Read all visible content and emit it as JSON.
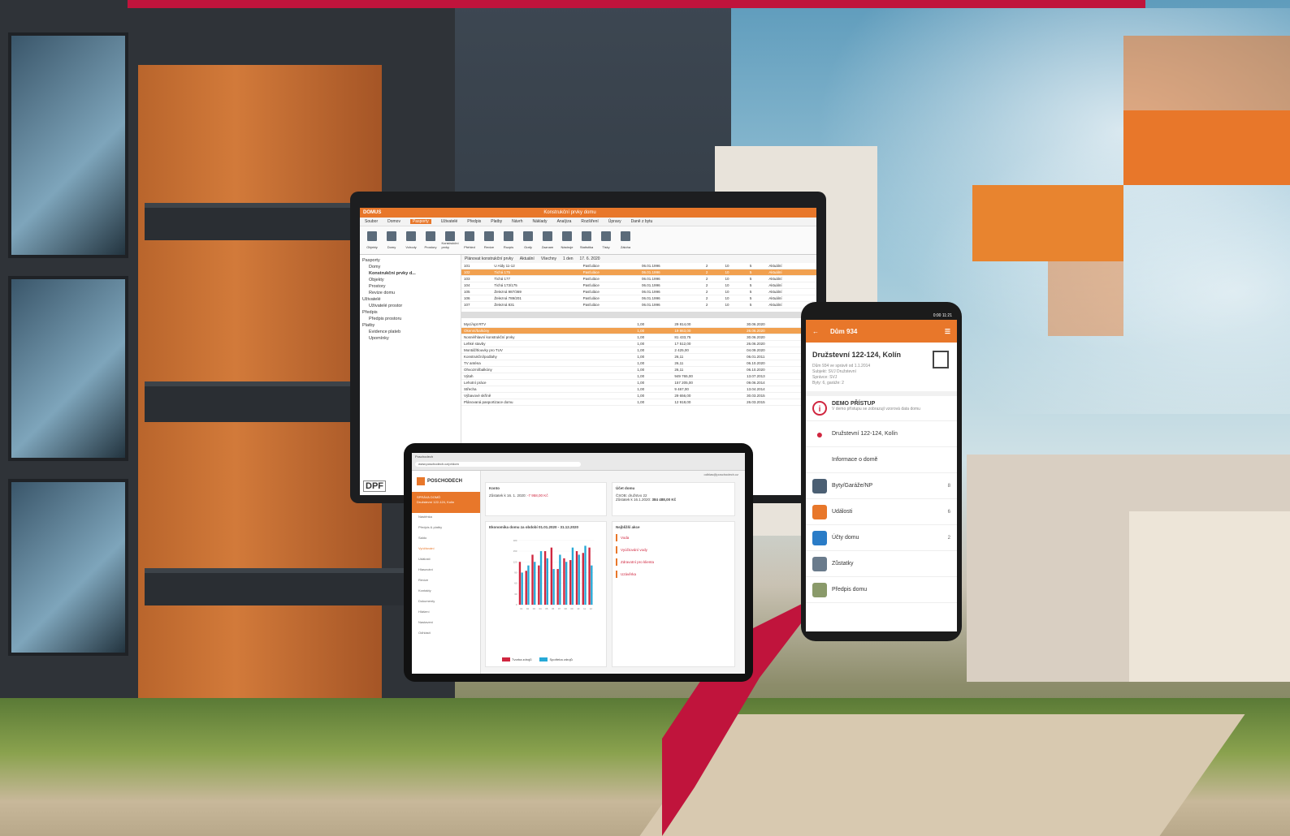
{
  "colors": {
    "accent": "#e8772a",
    "brand_red": "#c0143c",
    "bar_red": "#d0263f",
    "bar_blue": "#27a9d6"
  },
  "laptop": {
    "app_title": "DOMUS",
    "window_title": "Konstrukční prvky domu",
    "menu": [
      "Soubor",
      "Domov",
      "Pasporty",
      "Uživatelé",
      "Předpis",
      "Platby",
      "Návrh",
      "Náklady",
      "Analýza",
      "Rozšíření",
      "Úpravy",
      "Daně z bytu"
    ],
    "active_menu": "Pasporty",
    "ribbon": [
      "Objekty",
      "Domy",
      "Vchody",
      "Prostory",
      "Konstrukční prvky",
      "Přehled",
      "Revize",
      "Rozpis",
      "Grafy",
      "Zaznam",
      "Nástroje",
      "Statistika",
      "Tisky",
      "Záloha"
    ],
    "sidebar": [
      "Pasporty",
      "Domy",
      "Konstrukční prvky d...",
      "Objekty",
      "Prostory",
      "Revize domu",
      "Uživatelé",
      "Uživatelé prostor",
      "Předpis",
      "Předpis prostoru",
      "Platby",
      "Evidence plateb",
      "Upomínky"
    ],
    "filter": [
      "Plánovat konstrukční prvky",
      "Aktuální",
      "Všechny",
      "1 den",
      "17. 6. 2020"
    ],
    "rows_top": [
      [
        "101",
        "U Aldy 11-12",
        "Pasťuláce",
        "06.01.1996",
        "2",
        "10",
        "5",
        "Aktuální"
      ],
      [
        "102",
        "Tichá 175",
        "Pasťuláce",
        "06.01.1996",
        "2",
        "10",
        "5",
        "Aktuální"
      ],
      [
        "103",
        "Tichá 177",
        "Pasťuláce",
        "06.01.1996",
        "2",
        "10",
        "5",
        "Aktuální"
      ],
      [
        "104",
        "Tichá 173/175",
        "Pasťuláce",
        "06.01.1996",
        "2",
        "10",
        "5",
        "Aktuální"
      ],
      [
        "105",
        "Železná 987/369",
        "Pasťuláce",
        "06.01.1996",
        "2",
        "10",
        "5",
        "Aktuální"
      ],
      [
        "106",
        "Železná 789/201",
        "Pasťuláce",
        "06.01.1996",
        "2",
        "10",
        "5",
        "Aktuální"
      ],
      [
        "107",
        "Železná 831",
        "Pasťuláce",
        "06.01.1996",
        "2",
        "10",
        "5",
        "Aktuální"
      ]
    ],
    "rows_bottom": [
      [
        "Mycí/opt RTV",
        "1,00",
        "29 814,00",
        "30.06.2020"
      ],
      [
        "Okenní/balkóny",
        "1,00",
        "19 863,00",
        "26.06.2020"
      ],
      [
        "Nosné/hlavní konstrukční prvky",
        "1,00",
        "81 433,75",
        "30.06.2020"
      ],
      [
        "Lehké stavby",
        "1,00",
        "17 512,00",
        "26.06.2020"
      ],
      [
        "Montáž/tlouvky pro TUV",
        "1,00",
        "2 425,00",
        "04.09.2020"
      ],
      [
        "Konstrukční/podlahy",
        "1,00",
        "26,11",
        "06.01.2011"
      ],
      [
        "TV anténa",
        "1,00",
        "26,11",
        "06.10.2020"
      ],
      [
        "Ohvozmí/balkóny",
        "1,00",
        "26,11",
        "06.10.2020"
      ],
      [
        "Výtah",
        "1,00",
        "949 765,00",
        "13.07.2013"
      ],
      [
        "Lehotní práce",
        "1,00",
        "157 205,00",
        "09.06.2014"
      ],
      [
        "Střecha",
        "1,00",
        "9 467,00",
        "13.04.2014"
      ],
      [
        "Výbavové skříně",
        "1,00",
        "29 656,00",
        "30.03.2015"
      ],
      [
        "Plánovaná pasportizace domu",
        "1,00",
        "12 918,00",
        "26.03.2015"
      ]
    ],
    "logo": "DPF"
  },
  "tablet": {
    "tab": "Poschodech",
    "url": "www.poschodech.cz/pr/dom",
    "logo": "POSCHODECH",
    "org_name": "SPRÁVA DOMŮ",
    "org_sub": "Družstevní 122-124, Kolín",
    "nav": [
      "Nástěnka",
      "Předpis & platby",
      "Saldo",
      "Vyúčtování",
      "Události",
      "Hlasování",
      "Revize",
      "Kontakty",
      "Dokumenty",
      "Hlášení",
      "Nastavení",
      "Odhlásit"
    ],
    "active_nav": "Vyúčtování",
    "top_right": "odhlas@poschodech.cz",
    "card1_title": "Konto",
    "card1_text": "Zůstatek k 16. 1. 2020:",
    "card1_value": "-7 958,00 Kč",
    "card2_title": "Účet domu",
    "card2_text": "ČSOB: družstvo 22",
    "card2_sub": "Zůstatek k 16.1.2020:",
    "card2_value": "384 488,00 Kč",
    "chart_title": "Ekonomika domu za období 01.01.2020 - 31.12.2020",
    "notif_title": "Nejbližší akce",
    "notifs": [
      "Voda",
      "Vyúčtování vody",
      "Zdravotní pro klienta",
      "Uzávěrka"
    ]
  },
  "phone": {
    "status": "0:00 11:21",
    "title": "Dům 934",
    "address": "Družstevní 122-124, Kolín",
    "sub": [
      "Dům 934 ve správě od 1.1.2014",
      "Subjekt: SVJ Družstevní",
      "Správce: SVJ",
      "Byty: 6, garáže: 2"
    ],
    "demo_title": "DEMO PŘÍSTUP",
    "demo_text": "V demo přístupu se zobrazují vzorová data domu",
    "location": "Družstevní 122-124, Kolín",
    "info_link": "Informace o domě",
    "items": [
      {
        "label": "Byty/Garáže/NP",
        "count": "8"
      },
      {
        "label": "Události",
        "count": "6"
      },
      {
        "label": "Účty domu",
        "count": "2"
      },
      {
        "label": "Zůstatky",
        "count": ""
      },
      {
        "label": "Předpis domu",
        "count": ""
      }
    ]
  },
  "chart_data": {
    "type": "bar",
    "categories": [
      "01",
      "02",
      "03",
      "04",
      "05",
      "06",
      "07",
      "08",
      "09",
      "10",
      "11",
      "12"
    ],
    "series": [
      {
        "name": "Tvorba zdrojů",
        "values": [
          120,
          95,
          140,
          110,
          150,
          160,
          100,
          130,
          125,
          150,
          145,
          160
        ],
        "color": "#d0263f"
      },
      {
        "name": "Spotřeba zdrojů",
        "values": [
          90,
          110,
          120,
          150,
          130,
          100,
          140,
          120,
          160,
          140,
          165,
          110
        ],
        "color": "#27a9d6"
      }
    ],
    "ylim": [
      0,
      180
    ]
  }
}
